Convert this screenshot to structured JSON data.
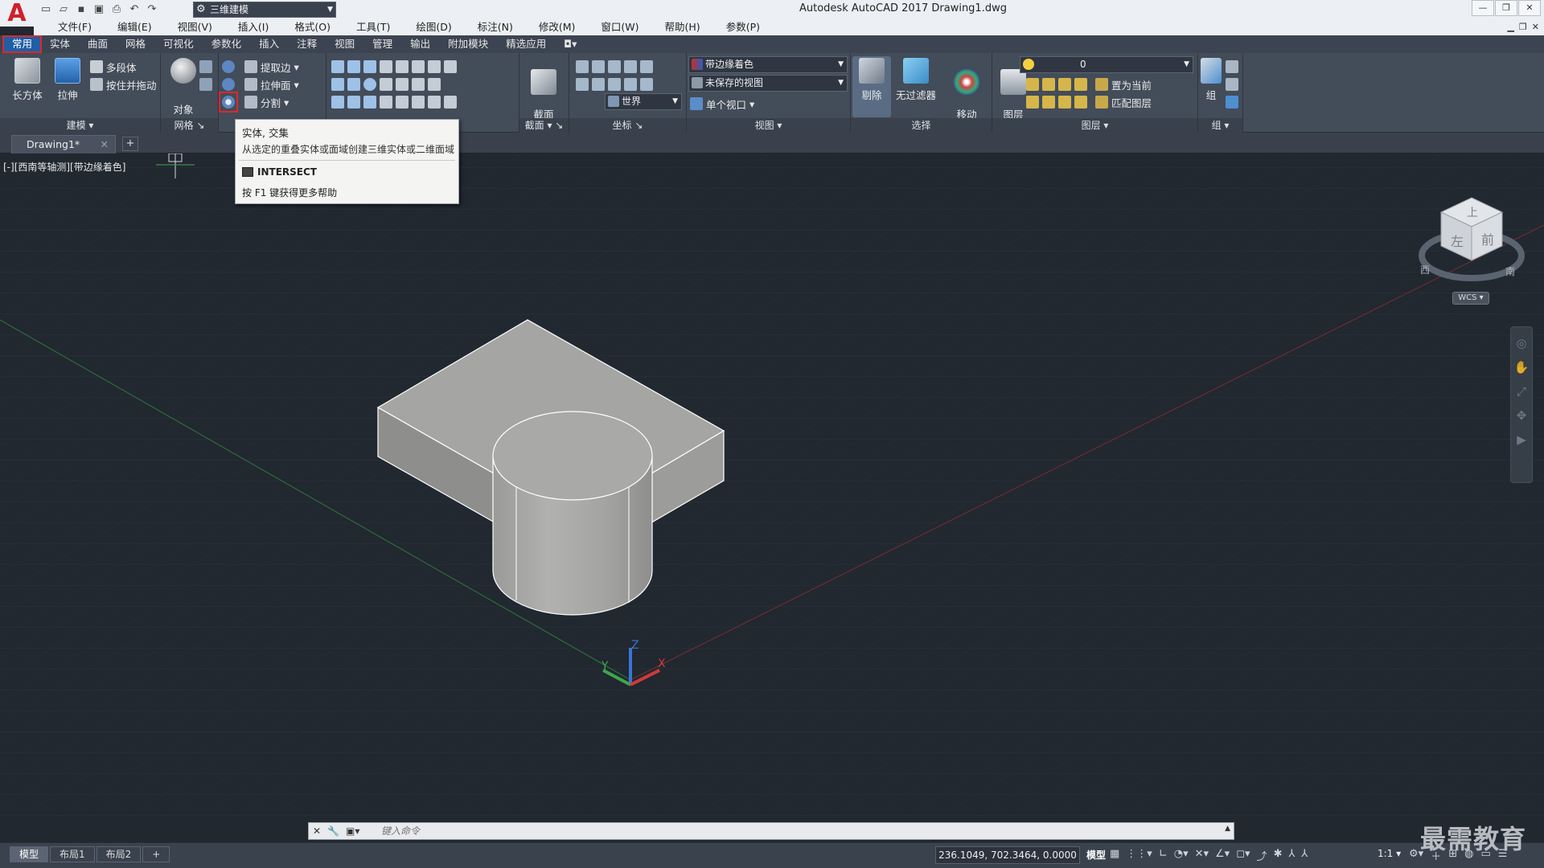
{
  "app": {
    "logo_letter": "A",
    "window_title": "Autodesk AutoCAD 2017    Drawing1.dwg",
    "workspace": "三维建模"
  },
  "menu": [
    "文件(F)",
    "编辑(E)",
    "视图(V)",
    "插入(I)",
    "格式(O)",
    "工具(T)",
    "绘图(D)",
    "标注(N)",
    "修改(M)",
    "窗口(W)",
    "帮助(H)",
    "参数(P)"
  ],
  "ribbon_tabs": [
    "常用",
    "实体",
    "曲面",
    "网格",
    "可视化",
    "参数化",
    "插入",
    "注释",
    "视图",
    "管理",
    "输出",
    "附加模块",
    "精选应用"
  ],
  "ribbon": {
    "modeling": {
      "title": "建模",
      "box": "长方体",
      "extrude": "拉伸",
      "polysolid": "多段体",
      "presspull": "按住并拖动"
    },
    "mesh": {
      "title": "网格",
      "object": "对象"
    },
    "solid_edit": {
      "extract_edges": "提取边",
      "extrude_face": "拉伸面",
      "separate": "分割"
    },
    "section": {
      "title": "截面",
      "plane": "截面\n平面"
    },
    "coords": {
      "title": "坐标",
      "world": "世界"
    },
    "view": {
      "title": "视图",
      "visual_style": "带边缘着色",
      "saved_view": "未保存的视图",
      "viewport": "单个视口"
    },
    "selection": {
      "title": "选择",
      "culling": "剔除",
      "no_filter": "无过滤器",
      "gizmo": "移动\n小控件"
    },
    "layers": {
      "title": "图层",
      "properties": "图层\n特性",
      "current_layer": "0",
      "set_current": "置为当前",
      "match_layer": "匹配图层"
    },
    "groups": {
      "title": "组",
      "group": "组"
    }
  },
  "tooltip": {
    "title": "实体, 交集",
    "description": "从选定的重叠实体或面域创建三维实体或二维面域",
    "command": "INTERSECT",
    "help": "按 F1 键获得更多帮助"
  },
  "document_tab": "Drawing1*",
  "viewport_label": "[-][西南等轴测][带边缘着色]",
  "viewcube": {
    "top": "上",
    "left": "左",
    "front": "前",
    "compass_w": "西",
    "compass_s": "南",
    "wcs": "WCS"
  },
  "ucs_axes": {
    "x": "X",
    "y": "Y",
    "z": "Z"
  },
  "command_line": {
    "placeholder": "键入命令"
  },
  "layout_tabs": [
    "模型",
    "布局1",
    "布局2"
  ],
  "status": {
    "coordinates": "236.1049, 702.3464, 0.0000",
    "model": "模型",
    "scale": "1:1"
  },
  "watermark": "最需教育",
  "colors": {
    "accent": "#1e5fa6",
    "highlight": "#e0262b",
    "viewport_bg": "#212830",
    "solid_face": "#a7a7a6"
  }
}
